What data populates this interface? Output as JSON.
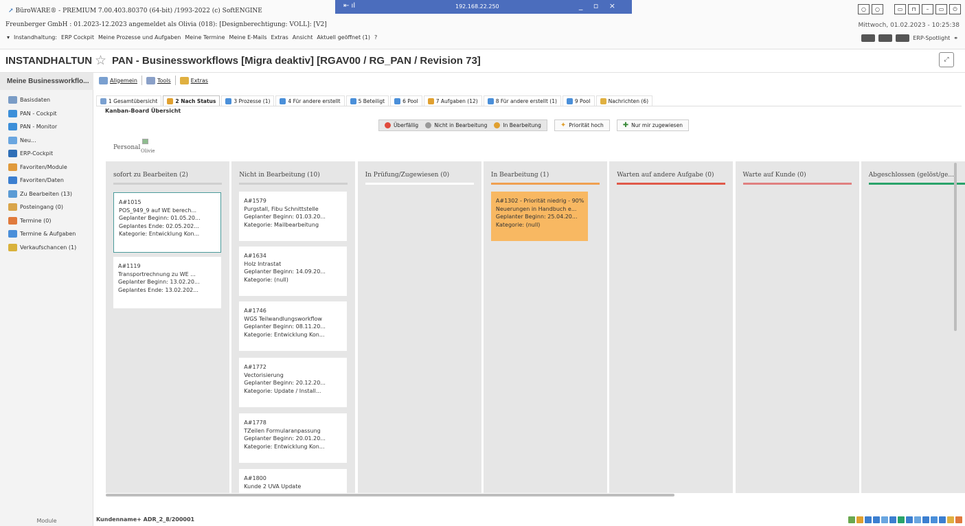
{
  "titlebar": {
    "app_line": "BüroWARE® - PREMIUM  7.00.403.80370 (64-bit) /1993-2022 (c) SoftENGINE",
    "company_line": "Freunberger GmbH : 01.2023-12.2023 angemeldet als Olivia (018): [Designberechtigung: VOLL]: [V2]",
    "menu": [
      "Instandhaltung:",
      "ERP Cockpit",
      "Meine Prozesse und Aufgaben",
      "Meine Termine",
      "Meine E-Mails",
      "Extras",
      "Ansicht",
      "Aktuell geöffnet (1)",
      "?"
    ],
    "remote_ip": "192.168.22.250",
    "datetime": "Mittwoch, 01.02.2023 - 10:25:38",
    "spotlight": "ERP-Spotlight"
  },
  "header": {
    "left_title": "INSTANDHALTUN",
    "page_title": "PAN - Businessworkflows [Migra deaktiv]  [RGAV00 / RG_PAN / Revision 73]"
  },
  "sidebar": {
    "title": "Meine Businessworkflo...",
    "items": [
      {
        "label": "Basisdaten",
        "color": "#7a9cc6"
      },
      {
        "label": "PAN - Cockpit",
        "color": "#3c8fd9"
      },
      {
        "label": "PAN - Monitor",
        "color": "#3c8fd9"
      },
      {
        "label": "Neu...",
        "color": "#6aa6e0"
      },
      {
        "label": "ERP-Cockpit",
        "color": "#2f6fb7"
      },
      {
        "label": "Favoriten/Module",
        "color": "#e09a3c"
      },
      {
        "label": "Favoriten/Daten",
        "color": "#3c7fd0"
      },
      {
        "label": "Zu Bearbeiten (13)",
        "color": "#5b9bd5"
      },
      {
        "label": "Posteingang (0)",
        "color": "#d9a54a"
      },
      {
        "label": "Termine (0)",
        "color": "#e07a3c"
      },
      {
        "label": "Termine & Aufgaben",
        "color": "#4a8fd9"
      },
      {
        "label": "Verkaufschancen (1)",
        "color": "#d9b23c"
      }
    ],
    "footer": "Module"
  },
  "toolbar": {
    "items": [
      {
        "label": "Allgemein",
        "color": "#7aa0d0"
      },
      {
        "label": "Tools",
        "color": "#8aa0c8"
      },
      {
        "label": "Extras",
        "color": "#e0b040"
      }
    ]
  },
  "tabs": [
    {
      "label": "1 Gesamtübersicht",
      "color": "#7aa0d0",
      "active": false
    },
    {
      "label": "2 Nach Status",
      "color": "#e0a030",
      "active": true
    },
    {
      "label": "3 Prozesse (1)",
      "color": "#4a8fd9",
      "active": false
    },
    {
      "label": "4 Für andere erstellt",
      "color": "#4a8fd9",
      "active": false
    },
    {
      "label": "5 Beteiligt",
      "color": "#4a8fd9",
      "active": false
    },
    {
      "label": "6 Pool",
      "color": "#4a8fd9",
      "active": false
    },
    {
      "label": "7 Aufgaben (12)",
      "color": "#e0a030",
      "active": false
    },
    {
      "label": "8 Für andere erstellt (1)",
      "color": "#4a8fd9",
      "active": false
    },
    {
      "label": "9 Pool",
      "color": "#4a8fd9",
      "active": false
    },
    {
      "label": "Nachrichten (6)",
      "color": "#e0b040",
      "active": false
    }
  ],
  "subtitle": "Kanban-Board Übersicht",
  "filters": {
    "status": [
      {
        "label": "Überfällig",
        "color": "#e04a3c"
      },
      {
        "label": "Nicht in Bearbeitung",
        "color": "#999999"
      },
      {
        "label": "In Bearbeitung",
        "color": "#e0a030"
      }
    ],
    "priority": "Priorität hoch",
    "assigned": "Nur mir zugewiesen"
  },
  "personal": {
    "label": "Personal",
    "avatar_name": "Olivie"
  },
  "board": {
    "columns": [
      {
        "title": "sofort zu Bearbeiten (2)",
        "bar_color": "#cfcfcf",
        "cards": [
          {
            "lines": [
              "A#1015",
              "POS_949_9 auf WE berech...",
              "Geplanter Beginn: 01.05.20...",
              "Geplantes Ende: 02.05.202...",
              "Kategorie: Entwicklung Kon..."
            ],
            "style": "selected"
          },
          {
            "lines": [
              "A#1119",
              "Transportrechnung zu WE ...",
              "Geplanter Beginn: 13.02.20...",
              "Geplantes Ende: 13.02.202..."
            ],
            "style": "normal"
          }
        ]
      },
      {
        "title": "Nicht in Bearbeitung (10)",
        "bar_color": "#cfcfcf",
        "cards": [
          {
            "lines": [
              "A#1579",
              "Purgstall, Fibu Schnittstelle",
              "Geplanter Beginn: 01.03.20...",
              "Kategorie: Mailbearbeitung"
            ],
            "style": "normal"
          },
          {
            "lines": [
              "A#1634",
              "Holz Intrastat",
              "Geplanter Beginn: 14.09.20...",
              "Kategorie: (null)"
            ],
            "style": "normal"
          },
          {
            "lines": [
              "A#1746",
              "WGS Teilwandlungsworkflow",
              "Geplanter Beginn: 08.11.20...",
              "Kategorie: Entwicklung Kon..."
            ],
            "style": "normal"
          },
          {
            "lines": [
              "A#1772",
              "Vectorisierung",
              "Geplanter Beginn: 20.12.20...",
              "Kategorie: Update / Install..."
            ],
            "style": "normal"
          },
          {
            "lines": [
              "A#1778",
              "TZeilen Formularanpassung",
              "Geplanter Beginn: 20.01.20...",
              "Kategorie: Entwicklung Kon..."
            ],
            "style": "normal"
          },
          {
            "lines": [
              "A#1800",
              "Kunde 2 UVA Update"
            ],
            "style": "normal"
          }
        ]
      },
      {
        "title": "In Prüfung/Zugewiesen (0)",
        "bar_color": "#ffffff",
        "cards": []
      },
      {
        "title": "In Bearbeitung (1)",
        "bar_color": "#f0a050",
        "cards": [
          {
            "lines": [
              "A#1302 - Priorität niedrig - 90%",
              "Neuerungen in Handbuch e...",
              "Geplanter Beginn: 25.04.20...",
              "Kategorie: (null)"
            ],
            "style": "orange"
          }
        ]
      },
      {
        "title": "Warten auf andere Aufgabe (0)",
        "bar_color": "#e05a4a",
        "cards": []
      },
      {
        "title": "Warte auf Kunde (0)",
        "bar_color": "#e08080",
        "cards": []
      },
      {
        "title": "Abgeschlossen (gelöst/ge...",
        "bar_color": "#2aa36a",
        "cards": []
      }
    ]
  },
  "statusbar": {
    "text": "Kundenname+ ADR_2_8/200001"
  }
}
